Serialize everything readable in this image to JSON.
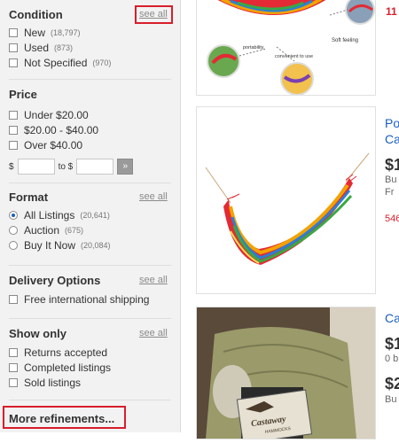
{
  "filters": {
    "condition": {
      "title": "Condition",
      "see_all": "see all",
      "items": [
        {
          "label": "New",
          "count": "(18,797)"
        },
        {
          "label": "Used",
          "count": "(873)"
        },
        {
          "label": "Not Specified",
          "count": "(970)"
        }
      ]
    },
    "price": {
      "title": "Price",
      "items": [
        {
          "label": "Under $20.00"
        },
        {
          "label": "$20.00 - $40.00"
        },
        {
          "label": "Over $40.00"
        }
      ],
      "currency_label": "$",
      "to_label": "to $",
      "go_label": "»"
    },
    "format": {
      "title": "Format",
      "see_all": "see all",
      "items": [
        {
          "label": "All Listings",
          "count": "(20,641)",
          "checked": true
        },
        {
          "label": "Auction",
          "count": "(675)"
        },
        {
          "label": "Buy It Now",
          "count": "(20,084)"
        }
      ]
    },
    "delivery": {
      "title": "Delivery Options",
      "see_all": "see all",
      "items": [
        {
          "label": "Free international shipping"
        }
      ]
    },
    "show_only": {
      "title": "Show only",
      "see_all": "see all",
      "items": [
        {
          "label": "Returns accepted"
        },
        {
          "label": "Completed listings"
        },
        {
          "label": "Sold listings"
        }
      ]
    },
    "more_refinements": "More refinements..."
  },
  "listings": [
    {
      "image_labels": {
        "portability": "portability",
        "soft_feeling": "Soft feeling",
        "convenient": "convenient to use"
      },
      "right_text": "11 -",
      "right_color": "#d81e2c"
    },
    {
      "title_partial_1": "Po",
      "title_partial_2": "Ca",
      "price_partial": "$1",
      "sub_partial": "Bu",
      "sub2_partial": "Fr",
      "red_partial": "546"
    },
    {
      "title_partial_1": "Ca",
      "price_partial_1": "$1",
      "sub_partial_1": "0 b",
      "price_partial_2": "$2",
      "sub_partial_2": "Bu",
      "brand_lines": [
        "Castaway",
        "HAMMOCKS"
      ]
    }
  ],
  "colors": {
    "sidebar_bg": "#f2f2f2",
    "highlight_red": "#d81e2c",
    "link_blue": "#1a5fbf"
  }
}
